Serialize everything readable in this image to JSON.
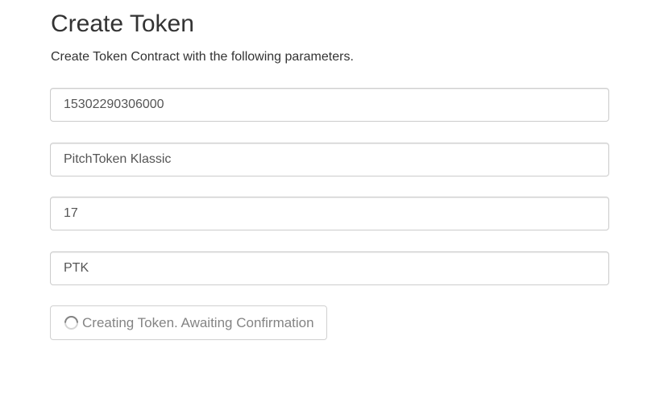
{
  "header": {
    "title": "Create Token",
    "subtitle": "Create Token Contract with the following parameters."
  },
  "form": {
    "fields": [
      {
        "value": "15302290306000"
      },
      {
        "value": "PitchToken Klassic"
      },
      {
        "value": "17"
      },
      {
        "value": "PTK"
      }
    ],
    "submit": {
      "label": "Creating Token. Awaiting Confirmation",
      "icon": "spinner-icon",
      "disabled": true
    }
  },
  "colors": {
    "text": "#333333",
    "field_border": "#cccccc",
    "button_text": "#777777"
  }
}
